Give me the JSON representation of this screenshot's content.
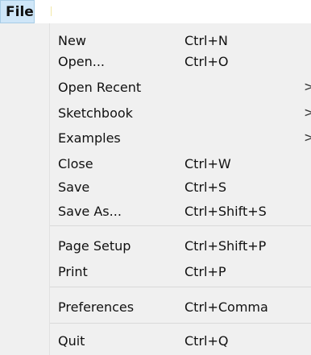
{
  "menubar": {
    "file_label": "File"
  },
  "menu": {
    "items": [
      {
        "label": "New",
        "shortcut": "Ctrl+N",
        "arrow": ""
      },
      {
        "label": "Open...",
        "shortcut": "Ctrl+O",
        "arrow": ""
      },
      {
        "label": "Open Recent",
        "shortcut": "",
        "arrow": ">"
      },
      {
        "label": "Sketchbook",
        "shortcut": "",
        "arrow": ">"
      },
      {
        "label": "Examples",
        "shortcut": "",
        "arrow": ">"
      },
      {
        "label": "Close",
        "shortcut": "Ctrl+W",
        "arrow": ""
      },
      {
        "label": "Save",
        "shortcut": "Ctrl+S",
        "arrow": ""
      },
      {
        "label": "Save As...",
        "shortcut": "Ctrl+Shift+S",
        "arrow": ""
      },
      {
        "label": "Page Setup",
        "shortcut": "Ctrl+Shift+P",
        "arrow": ""
      },
      {
        "label": "Print",
        "shortcut": "Ctrl+P",
        "arrow": ""
      },
      {
        "label": "Preferences",
        "shortcut": "Ctrl+Comma",
        "arrow": ""
      },
      {
        "label": "Quit",
        "shortcut": "Ctrl+Q",
        "arrow": ""
      }
    ]
  }
}
